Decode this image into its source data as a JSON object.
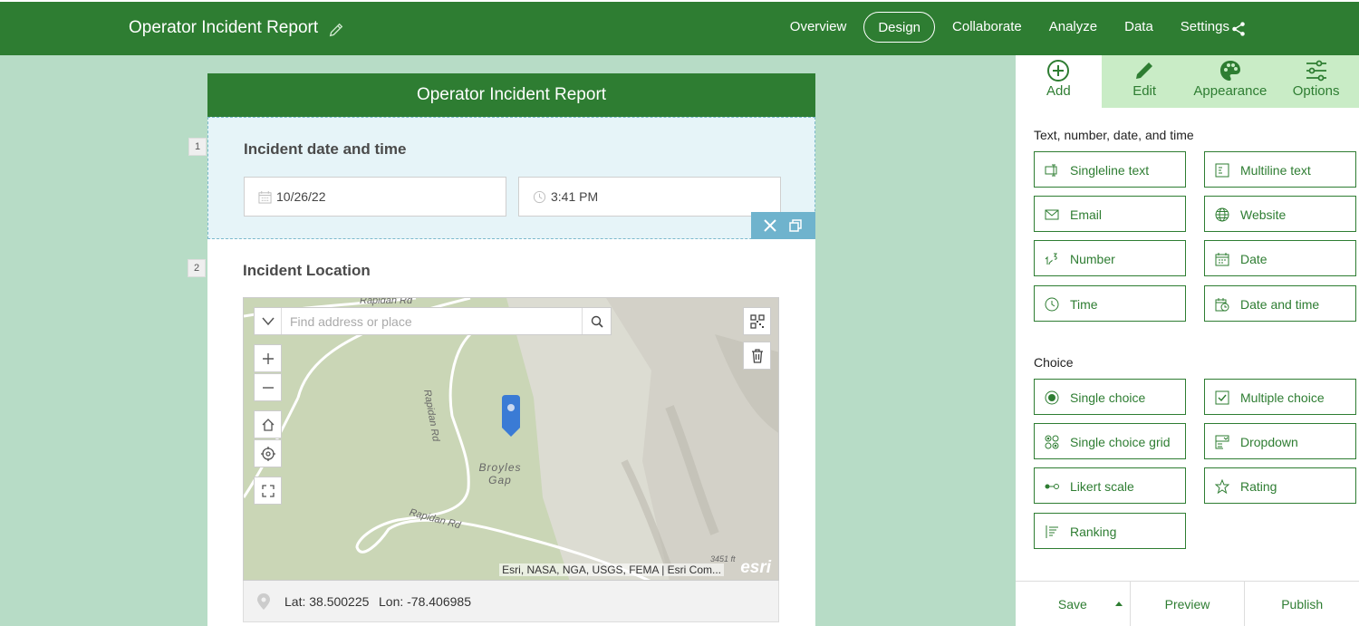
{
  "header": {
    "title": "Operator Incident Report",
    "nav": [
      "Overview",
      "Design",
      "Collaborate",
      "Analyze",
      "Data",
      "Settings"
    ],
    "active_nav": "Design"
  },
  "form": {
    "title": "Operator Incident Report",
    "questions": [
      {
        "number": "1",
        "title": "Incident date and time",
        "date_value": "10/26/22",
        "time_value": "3:41 PM"
      },
      {
        "number": "2",
        "title": "Incident Location",
        "search_placeholder": "Find address or place",
        "map_labels": [
          "Rapidan Rd",
          "Rapidan Rd",
          "Broyles Gap",
          "Rapidan Rd",
          "3451 ft"
        ],
        "attribution": "Esri, NASA, NGA, USGS, FEMA | Esri Com...",
        "logo": "esri",
        "lat_label": "Lat: 38.500225",
        "lon_label": "Lon: -78.406985"
      }
    ]
  },
  "panel": {
    "tabs": [
      {
        "label": "Add",
        "icon": "add-circle-icon"
      },
      {
        "label": "Edit",
        "icon": "pencil-icon"
      },
      {
        "label": "Appearance",
        "icon": "palette-icon"
      },
      {
        "label": "Options",
        "icon": "sliders-icon"
      }
    ],
    "sections": [
      {
        "title": "Text, number, date, and time",
        "items": [
          "Singleline text",
          "Multiline text",
          "Email",
          "Website",
          "Number",
          "Date",
          "Time",
          "Date and time"
        ]
      },
      {
        "title": "Choice",
        "items": [
          "Single choice",
          "Multiple choice",
          "Single choice grid",
          "Dropdown",
          "Likert scale",
          "Rating",
          "Ranking"
        ]
      }
    ],
    "footer": [
      "Save",
      "Preview",
      "Publish"
    ]
  },
  "colors": {
    "brand_green": "#2e7d32",
    "background": "#b7dcc6",
    "selected_question": "#e6f4f8"
  }
}
